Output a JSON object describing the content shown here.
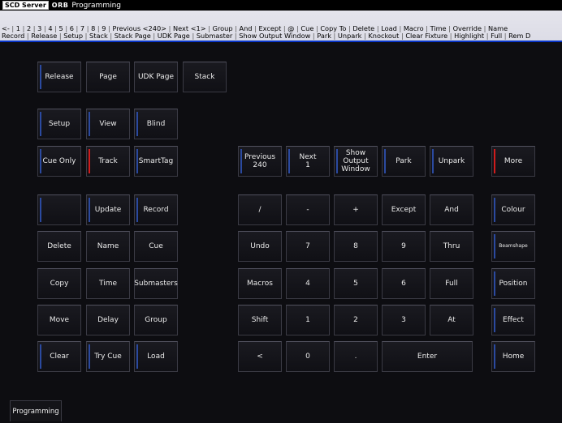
{
  "titlebar": {
    "logo_text": "SCD Server",
    "orb_text": "ORB",
    "title": "Programming"
  },
  "cmdbar": {
    "row1": [
      "<-",
      "1",
      "2",
      "3",
      "4",
      "5",
      "6",
      "7",
      "8",
      "9",
      "Previous <240>",
      "Next <1>",
      "Group",
      "And",
      "Except",
      "@",
      "Cue",
      "Copy To",
      "Delete",
      "Load",
      "Macro",
      "Time",
      "Override",
      "Name"
    ],
    "row2": [
      "Record",
      "Release",
      "Setup",
      "Stack",
      "Stack Page",
      "UDK Page",
      "Submaster",
      "Show Output Window",
      "Park",
      "Unpark",
      "Knockout",
      "Clear Fixture",
      "Highlight",
      "Full",
      "Rem D"
    ]
  },
  "colors": {
    "accent_blue": "#2b4aa0",
    "accent_red": "#d11c1c",
    "cmd_blue_bar": "#0a36c9"
  },
  "keys": {
    "release": "Release",
    "page": "Page",
    "udk_page": "UDK Page",
    "stack": "Stack",
    "setup": "Setup",
    "view": "View",
    "blind": "Blind",
    "cue_only": "Cue Only",
    "track": "Track",
    "smarttag": "SmartTag",
    "previous": "Previous\n240",
    "next": "Next\n1",
    "show_output_window": "Show\nOutput\nWindow",
    "park": "Park",
    "unpark": "Unpark",
    "more": "More",
    "blank": "",
    "update": "Update",
    "record": "Record",
    "slash": "/",
    "minus": "-",
    "plus": "+",
    "except": "Except",
    "and": "And",
    "colour": "Colour",
    "delete": "Delete",
    "name": "Name",
    "cue": "Cue",
    "undo": "Undo",
    "k7": "7",
    "k8": "8",
    "k9": "9",
    "thru": "Thru",
    "beamshape": "Beamshape",
    "copy": "Copy",
    "time": "Time",
    "submasters": "Submasters",
    "macros": "Macros",
    "k4": "4",
    "k5": "5",
    "k6": "6",
    "full": "Full",
    "position": "Position",
    "move": "Move",
    "delay": "Delay",
    "group": "Group",
    "shift": "Shift",
    "k1": "1",
    "k2": "2",
    "k3": "3",
    "at": "At",
    "effect": "Effect",
    "clear": "Clear",
    "try_cue": "Try Cue",
    "load": "Load",
    "less": "<",
    "k0": "0",
    "dot": ".",
    "enter": "Enter",
    "home": "Home"
  },
  "bottom_tab": "Programming"
}
